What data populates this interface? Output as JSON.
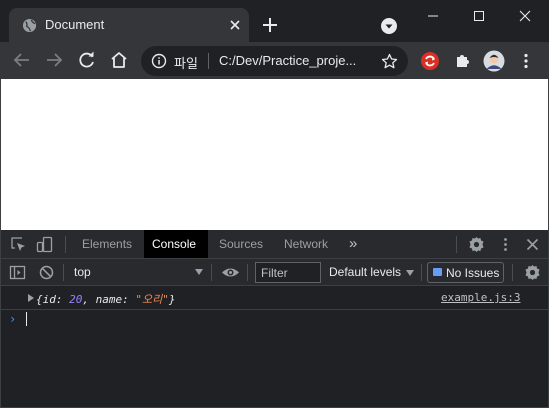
{
  "browser": {
    "tab_title": "Document",
    "omnibox_label": "파일",
    "url": "C:/Dev/Practice_proje..."
  },
  "devtools": {
    "tabs": [
      {
        "label": "Elements"
      },
      {
        "label": "Console",
        "active": true
      },
      {
        "label": "Sources"
      },
      {
        "label": "Network"
      }
    ],
    "more_tabs": "»",
    "context": "top",
    "filter_placeholder": "Filter",
    "levels_label": "Default levels",
    "issues_label": "No Issues",
    "log": {
      "open": "{",
      "key1": "id",
      "sep1": ": ",
      "val1": "20",
      "comma": ", ",
      "key2": "name",
      "sep2": ": ",
      "val2": "\"오리\"",
      "close": "}",
      "source": "example.js:3"
    },
    "prompt": "›"
  },
  "colors": {
    "chrome_frame": "#202124",
    "toolbar": "#35363a",
    "number_literal": "#9980ff",
    "string_literal": "#f28b54",
    "prompt_blue": "#4e8cf7"
  }
}
